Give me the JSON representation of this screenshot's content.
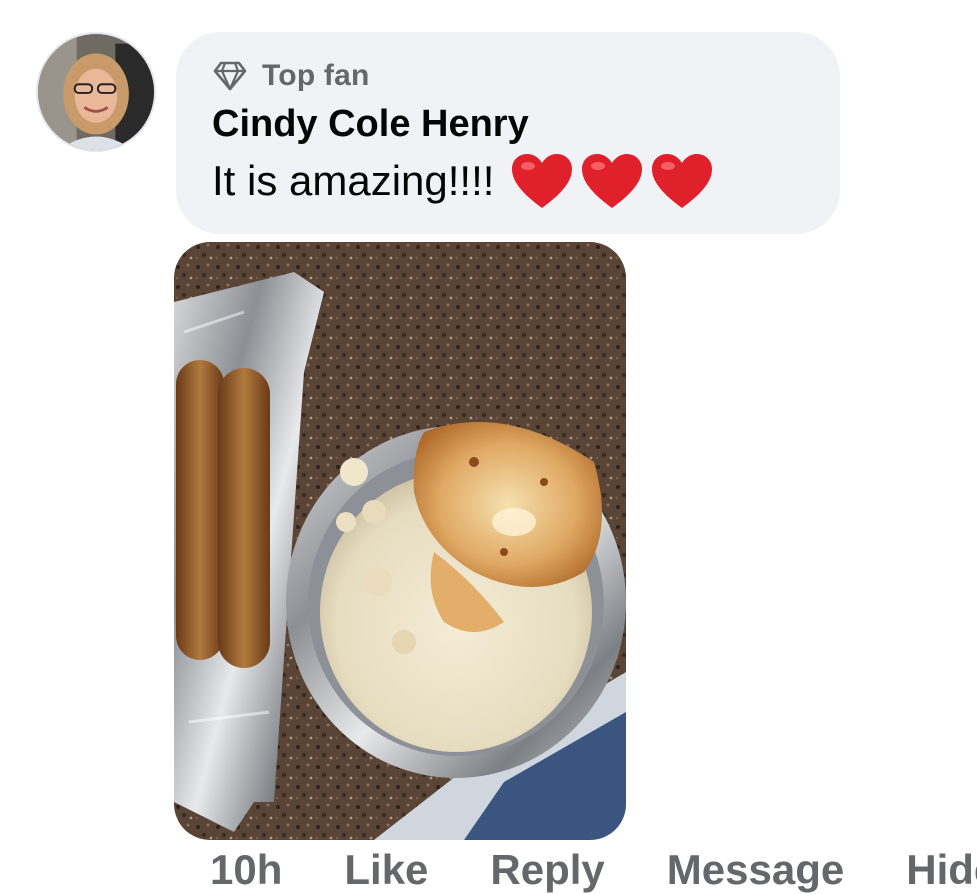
{
  "comment": {
    "badge": {
      "icon": "diamond-icon",
      "label": "Top fan"
    },
    "author": "Cindy Cole Henry",
    "text": "It is amazing!!!!",
    "emoji": [
      "heart-icon",
      "heart-icon",
      "heart-icon"
    ],
    "attachment": {
      "icon": "photo-food-dish"
    }
  },
  "actions": {
    "time": "10h",
    "like": "Like",
    "reply": "Reply",
    "message": "Message",
    "hide": "Hide"
  },
  "colors": {
    "bubble": "#f0f2f5",
    "secondary_text": "#65676b",
    "primary_text": "#050505",
    "heart": "#e0202b"
  }
}
